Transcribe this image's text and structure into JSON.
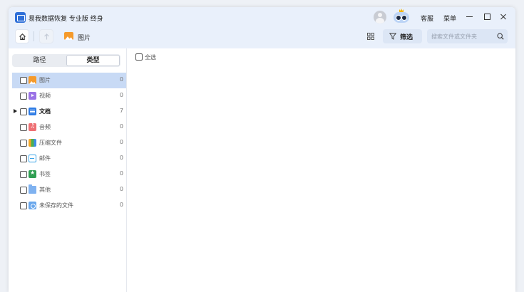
{
  "window": {
    "title": "易我数据恢复 专业版 终身",
    "service_label": "客服",
    "menu_label": "菜单"
  },
  "breadcrumb": {
    "current": "图片"
  },
  "toolbar": {
    "filter_label": "筛选",
    "search_placeholder": "搜索文件或文件夹"
  },
  "sidebar": {
    "tabs": [
      {
        "label": "路径",
        "active": false
      },
      {
        "label": "类型",
        "active": true
      }
    ],
    "items": [
      {
        "label": "图片",
        "count": "0",
        "icon": "image-icon"
      },
      {
        "label": "视频",
        "count": "0",
        "icon": "video-icon"
      },
      {
        "label": "文档",
        "count": "7",
        "icon": "document-icon"
      },
      {
        "label": "音频",
        "count": "0",
        "icon": "audio-icon"
      },
      {
        "label": "压缩文件",
        "count": "0",
        "icon": "archive-icon"
      },
      {
        "label": "邮件",
        "count": "0",
        "icon": "mail-icon"
      },
      {
        "label": "书签",
        "count": "0",
        "icon": "bookmark-icon"
      },
      {
        "label": "其他",
        "count": "0",
        "icon": "folder-icon"
      },
      {
        "label": "未保存的文件",
        "count": "0",
        "icon": "unsaved-file-icon"
      }
    ]
  },
  "content": {
    "select_all_label": "全选"
  },
  "colors": {
    "accent": "#2e6fd8",
    "titlebar_bg": "#e9f0fb",
    "selected_row": "#c8daf5",
    "background": "#eef1f6"
  }
}
